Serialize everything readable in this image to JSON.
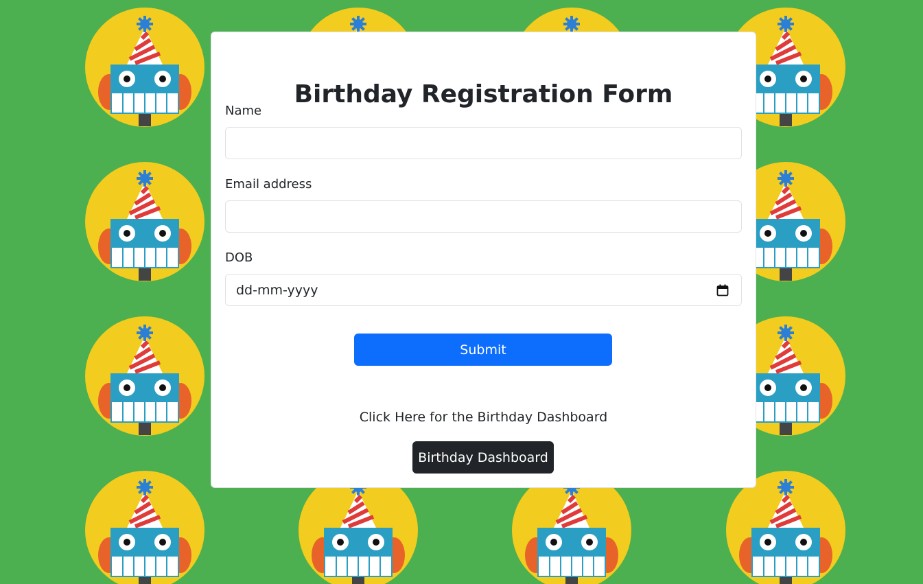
{
  "form": {
    "title": "Birthday Registration Form",
    "fields": [
      {
        "label": "Name",
        "value": "",
        "placeholder": ""
      },
      {
        "label": "Email address",
        "value": "",
        "placeholder": ""
      },
      {
        "label": "DOB",
        "value": "dd-mm-yyyy",
        "placeholder": "dd-mm-yyyy"
      }
    ],
    "submit_label": "Submit",
    "dashboard_prompt": "Click Here for the Birthday Dashboard",
    "dashboard_button_label": "Birthday Dashboard"
  },
  "icons": {
    "background_tile": "robot-party-hat-icon",
    "calendar": "calendar-icon"
  },
  "colors": {
    "background": "#4caf50",
    "primary": "#0d6efd",
    "dark": "#212529"
  }
}
